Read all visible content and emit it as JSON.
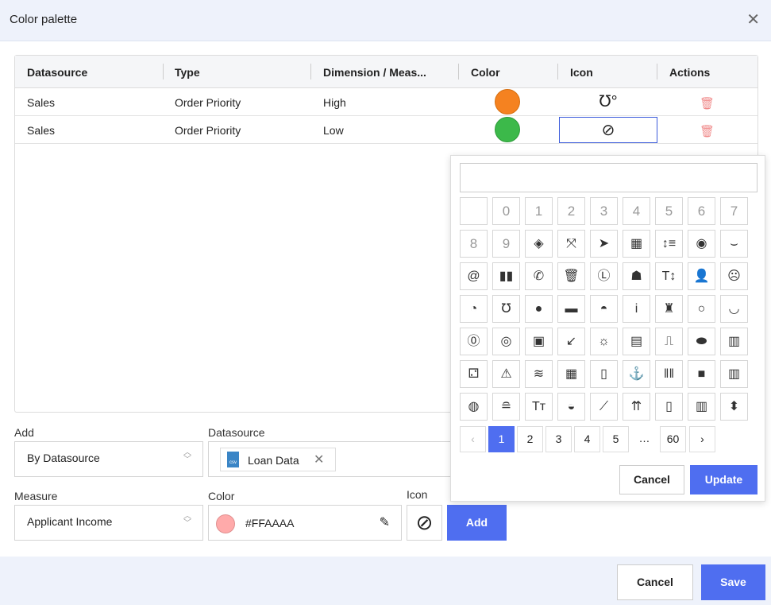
{
  "dialog": {
    "title": "Color palette",
    "close_icon": "close-icon"
  },
  "table": {
    "headers": [
      "Datasource",
      "Type",
      "Dimension / Meas...",
      "Color",
      "Icon",
      "Actions"
    ],
    "rows": [
      {
        "datasource": "Sales",
        "type": "Order Priority",
        "value": "High",
        "color": "#f58220",
        "icon": "stethoscope-icon",
        "glyph": "℧°"
      },
      {
        "datasource": "Sales",
        "type": "Order Priority",
        "value": "Low",
        "color": "#3cb94a",
        "icon": "ban-icon",
        "glyph": "⃠"
      }
    ]
  },
  "form": {
    "add_label": "Add",
    "add_value": "By Datasource",
    "datasource_label": "Datasource",
    "datasource_chip": "Loan Data",
    "measure_label": "Measure",
    "measure_value": "Applicant Income",
    "color_label": "Color",
    "color_value": "#FFAAAA",
    "color_swatch": "#ffaaaa",
    "icon_label": "Icon",
    "add_button": "Add"
  },
  "picker": {
    "search_placeholder": "",
    "icons": [
      {
        "n": "blank",
        "g": ""
      },
      {
        "n": "0",
        "g": "0"
      },
      {
        "n": "1",
        "g": "1"
      },
      {
        "n": "2",
        "g": "2"
      },
      {
        "n": "3",
        "g": "3"
      },
      {
        "n": "4",
        "g": "4"
      },
      {
        "n": "5",
        "g": "5"
      },
      {
        "n": "6",
        "g": "6"
      },
      {
        "n": "7",
        "g": "7"
      },
      {
        "n": "8",
        "g": "8"
      },
      {
        "n": "9",
        "g": "9"
      },
      {
        "n": "fill-drip",
        "g": "◈"
      },
      {
        "n": "compress-arrows",
        "g": "⤧"
      },
      {
        "n": "chevron-circle-right",
        "g": "➤"
      },
      {
        "n": "wagon",
        "g": "▦"
      },
      {
        "n": "line-height",
        "g": "↕≡"
      },
      {
        "n": "compact-disc",
        "g": "◉"
      },
      {
        "n": "grin-beam",
        "g": "⌣"
      },
      {
        "n": "at",
        "g": "@"
      },
      {
        "n": "tablets",
        "g": "▮▮"
      },
      {
        "n": "phone-outgoing",
        "g": "✆"
      },
      {
        "n": "trash",
        "g": "🗑"
      },
      {
        "n": "clock-l",
        "g": "Ⓛ"
      },
      {
        "n": "head-vr",
        "g": "☗"
      },
      {
        "n": "text-height",
        "g": "T↕"
      },
      {
        "n": "user-times",
        "g": "👤"
      },
      {
        "n": "sad-cry",
        "g": "☹"
      },
      {
        "n": "tachometer",
        "g": "◔"
      },
      {
        "n": "stethoscope",
        "g": "℧"
      },
      {
        "n": "lightbulb",
        "g": "●"
      },
      {
        "n": "comment",
        "g": "▬"
      },
      {
        "n": "salad",
        "g": "◓"
      },
      {
        "n": "info",
        "g": "i"
      },
      {
        "n": "robot",
        "g": "♜"
      },
      {
        "n": "ring",
        "g": "○"
      },
      {
        "n": "bowl-chopsticks",
        "g": "◡"
      },
      {
        "n": "zero",
        "g": "⓪"
      },
      {
        "n": "mask",
        "g": "◎"
      },
      {
        "n": "address-card",
        "g": "▣"
      },
      {
        "n": "compress-alt",
        "g": "↙"
      },
      {
        "n": "sunrise",
        "g": "☼"
      },
      {
        "n": "file-alt",
        "g": "▤"
      },
      {
        "n": "wave-square",
        "g": "⎍"
      },
      {
        "n": "ring-oval",
        "g": "⬬"
      },
      {
        "n": "building",
        "g": "▥"
      },
      {
        "n": "dice-two",
        "g": "⚁"
      },
      {
        "n": "tire-pressure",
        "g": "⚠"
      },
      {
        "n": "wifi",
        "g": "≋"
      },
      {
        "n": "calendar",
        "g": "▦"
      },
      {
        "n": "ipod",
        "g": "▯"
      },
      {
        "n": "anchor-check",
        "g": "⚓"
      },
      {
        "n": "barcode",
        "g": "‖‖"
      },
      {
        "n": "jar",
        "g": "■"
      },
      {
        "n": "building-plus",
        "g": "▥"
      },
      {
        "n": "volleyball",
        "g": "◍"
      },
      {
        "n": "sunset",
        "g": "≘"
      },
      {
        "n": "text-size",
        "g": "Tт"
      },
      {
        "n": "ufo",
        "g": "◒"
      },
      {
        "n": "fork",
        "g": "⟋"
      },
      {
        "n": "arrows-to-top",
        "g": "⇈"
      },
      {
        "n": "mobile-signal",
        "g": "▯"
      },
      {
        "n": "barcode-read",
        "g": "▥"
      },
      {
        "n": "sort",
        "g": "⬍"
      }
    ],
    "pagination": [
      "‹",
      "1",
      "2",
      "3",
      "4",
      "5",
      "…",
      "60",
      "›"
    ],
    "current_page": "1",
    "cancel": "Cancel",
    "update": "Update"
  },
  "footer": {
    "cancel": "Cancel",
    "save": "Save"
  },
  "accent": "#4f6ef0"
}
